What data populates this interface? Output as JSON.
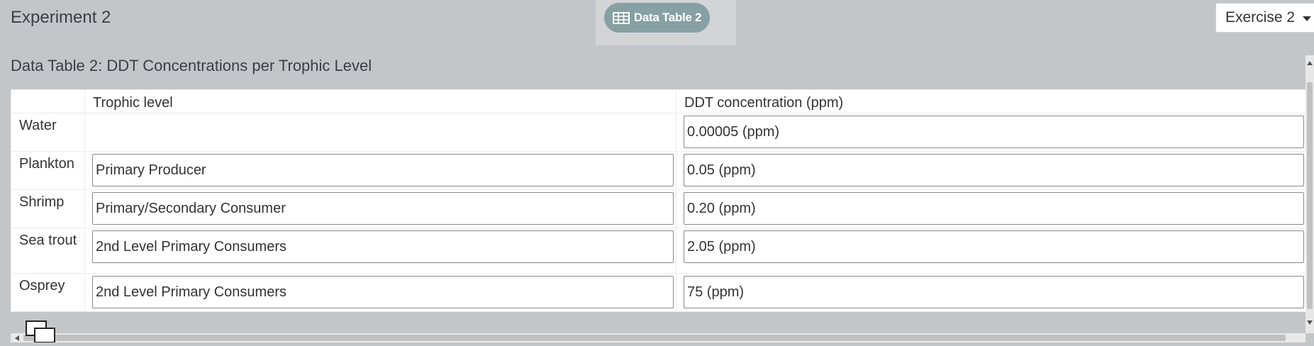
{
  "header": {
    "title": "Experiment 2",
    "tab_label": "Data Table 2",
    "tab_icon": "table-icon",
    "exercise_select": "Exercise 2"
  },
  "data_table": {
    "title": "Data Table 2: DDT Concentrations per Trophic Level",
    "columns": [
      "",
      "Trophic level",
      "DDT concentration (ppm)"
    ],
    "rows": [
      {
        "label": "Water",
        "trophic": null,
        "ddt": "0.00005 (ppm)"
      },
      {
        "label": "Plankton",
        "trophic": "Primary Producer",
        "ddt": "0.05 (ppm)"
      },
      {
        "label": "Shrimp",
        "trophic": "Primary/Secondary Consumer",
        "ddt": "0.20 (ppm)"
      },
      {
        "label": "Sea trout",
        "trophic": "2nd Level Primary Consumers",
        "ddt": "2.05 (ppm)"
      },
      {
        "label": "Osprey",
        "trophic": "2nd Level Primary Consumers",
        "ddt": "75 (ppm)"
      }
    ]
  },
  "colors": {
    "background": "#c3c6c9",
    "tab_pill": "#86a0a3",
    "tab_zone": "#d3d4d6"
  }
}
